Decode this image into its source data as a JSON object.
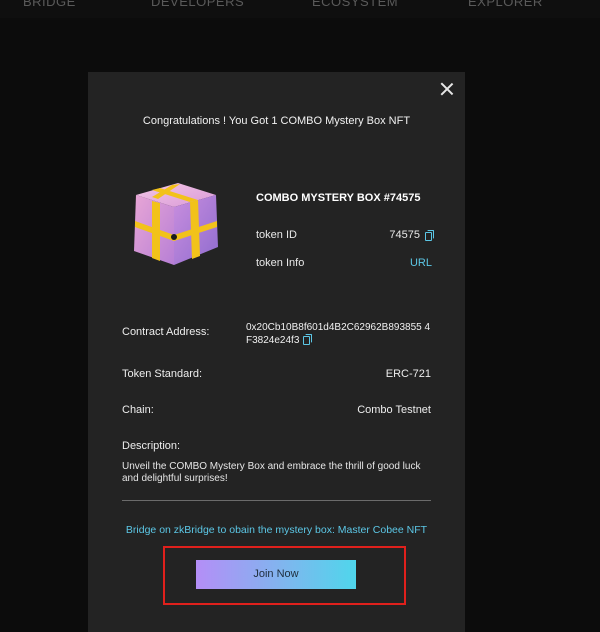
{
  "nav": {
    "items": [
      "BRIDGE",
      "DEVELOPERS",
      "ECOSYSTEM",
      "EXPLORER"
    ]
  },
  "modal": {
    "congrats": "Congratulations ! You Got 1 COMBO Mystery Box NFT",
    "nft": {
      "title": "COMBO MYSTERY BOX #74575",
      "token_id_label": "token ID",
      "token_id_value": "74575",
      "token_info_label": "token Info",
      "token_info_value": "URL"
    },
    "contract_label": "Contract Address:",
    "contract_value": "0x20Cb10B8f601d4B2C62962B893855 4F3824e24f3",
    "standard_label": "Token Standard:",
    "standard_value": "ERC-721",
    "chain_label": "Chain:",
    "chain_value": "Combo Testnet",
    "description_label": "Description:",
    "description_value": "Unveil the COMBO Mystery Box and embrace the thrill of good luck and delightful surprises!",
    "bridge_text": "Bridge on zkBridge to obain the mystery box: Master Cobee NFT",
    "join_label": "Join Now"
  },
  "colors": {
    "accent": "#5cc7e6",
    "highlight": "#e0201c",
    "modal_bg": "#232323"
  },
  "icons": [
    "close-icon",
    "copy-icon"
  ]
}
